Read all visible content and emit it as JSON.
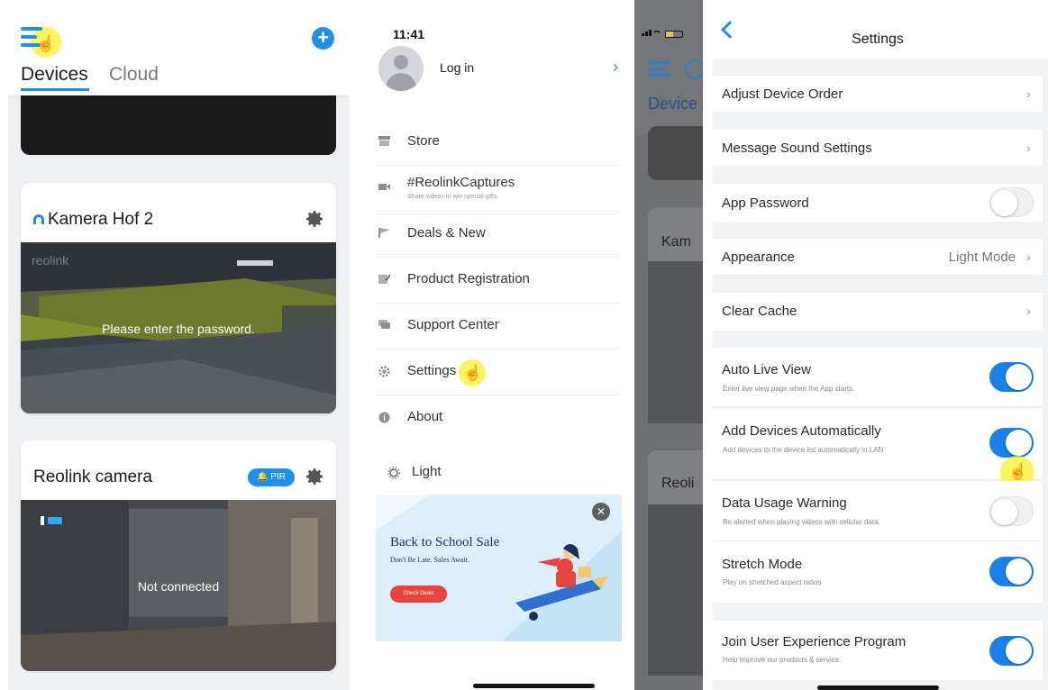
{
  "devices": {
    "tabs": [
      "Devices",
      "Cloud"
    ],
    "cameras": [
      {
        "name": "Kamera Hof 2",
        "message": "Please enter the password.",
        "overlay_brand": "reolink"
      },
      {
        "name": "Reolink camera",
        "badge": "PIR",
        "message": "Not connected"
      }
    ],
    "accent": "#1f8fe9"
  },
  "drawer": {
    "status_time": "11:41",
    "login": "Log in",
    "menu": [
      {
        "label": "Store",
        "icon": "store-icon"
      },
      {
        "label": "#ReolinkCaptures",
        "subtitle": "Share videos to win special gifts.",
        "icon": "video-icon"
      },
      {
        "label": "Deals & New",
        "icon": "flag-icon"
      },
      {
        "label": "Product Registration",
        "icon": "edit-icon"
      },
      {
        "label": "Support Center",
        "icon": "chat-icon"
      },
      {
        "label": "Settings",
        "icon": "gear-icon"
      },
      {
        "label": "About",
        "icon": "info-icon"
      }
    ],
    "theme_label": "Light",
    "banner": {
      "title": "Back to School Sale",
      "subtitle": "Don't Be Late. Sales Await.",
      "button": "Check Deals"
    }
  },
  "background_peek": {
    "tab": "Device",
    "card_1": "Kam",
    "card_2": "Reoli"
  },
  "settings": {
    "title": "Settings",
    "rows": [
      {
        "label": "Adjust Device Order",
        "type": "nav"
      },
      {
        "label": "Message Sound Settings",
        "type": "nav"
      },
      {
        "label": "App Password",
        "type": "toggle",
        "on": false
      },
      {
        "label": "Appearance",
        "type": "nav",
        "value": "Light Mode"
      },
      {
        "label": "Clear Cache",
        "type": "nav"
      },
      {
        "label": "Auto Live View",
        "desc": "Enter live view page when the App starts.",
        "type": "toggle",
        "on": true
      },
      {
        "label": "Add Devices Automatically",
        "desc": "Add devices to the device list automatically in LAN",
        "type": "toggle",
        "on": true
      },
      {
        "label": "Data Usage Warning",
        "desc": "Be alerted when playing videos with cellular data.",
        "type": "toggle",
        "on": false
      },
      {
        "label": "Stretch Mode",
        "desc": "Play on stretched aspect ratios",
        "type": "toggle",
        "on": true
      },
      {
        "label": "Join User Experience Program",
        "desc": "Help improve our products & service.",
        "type": "toggle",
        "on": true
      }
    ],
    "toggle_on_color": "#1a80e5"
  }
}
